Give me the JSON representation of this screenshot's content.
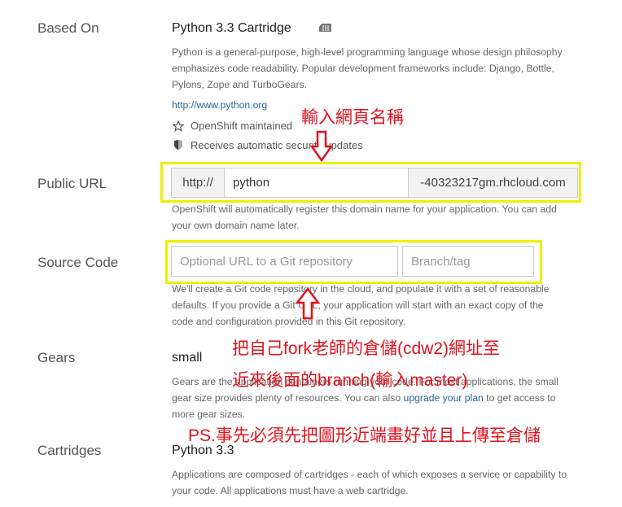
{
  "based_on": {
    "label": "Based On",
    "cartridge_name": "Python 3.3 Cartridge",
    "description_lines": [
      "Python is a general-purpose, high-level programming language whose design philosophy",
      "emphasizes code readability. Popular development frameworks include: Django, Bottle,",
      "Pylons, Zope and TurboGears."
    ],
    "link_text": "http://www.python.org",
    "maintained_text": "OpenShift maintained",
    "security_text": "Receives automatic security updates"
  },
  "public_url": {
    "label": "Public URL",
    "prefix": "http://",
    "value": "python",
    "suffix": "-40323217gm.rhcloud.com",
    "help_lines": [
      "OpenShift will automatically register this domain name for your application. You can add",
      "your own domain name later."
    ]
  },
  "source_code": {
    "label": "Source Code",
    "repo_placeholder": "Optional URL to a Git repository",
    "branch_placeholder": "Branch/tag",
    "help_lines": [
      "We'll create a Git code repository in the cloud, and populate it with a set of reasonable",
      "defaults. If you provide a Git URL, your application will start with an exact copy of the",
      "code and configuration provided in this Git repository."
    ]
  },
  "gears": {
    "label": "Gears",
    "value": "small",
    "help_line1": "Gears are the application containers running your code. For most applications, the small",
    "help_line2_pre": "gear size provides plenty of resources. You can also ",
    "help_link": "upgrade your plan",
    "help_line2_post": " to get access to",
    "help_line3": "more gear sizes."
  },
  "cartridges": {
    "label": "Cartridges",
    "value": "Python 3.3",
    "help_lines": [
      "Applications are composed of cartridges - each of which exposes a service or capability to",
      "your code. All applications must have a web cartridge."
    ]
  },
  "annotations": {
    "enter_name": "輸入網頁名稱",
    "fork_line1": "把自己fork老師的倉儲(cdw2)網址至",
    "fork_line2": "近來後面的branch(輸入master)",
    "ps": "PS.事先必須先把圖形近端畫好並且上傳至倉儲"
  },
  "colors": {
    "highlight": "#f2ee00",
    "annotation": "#e0141e",
    "link": "#2a6496"
  }
}
